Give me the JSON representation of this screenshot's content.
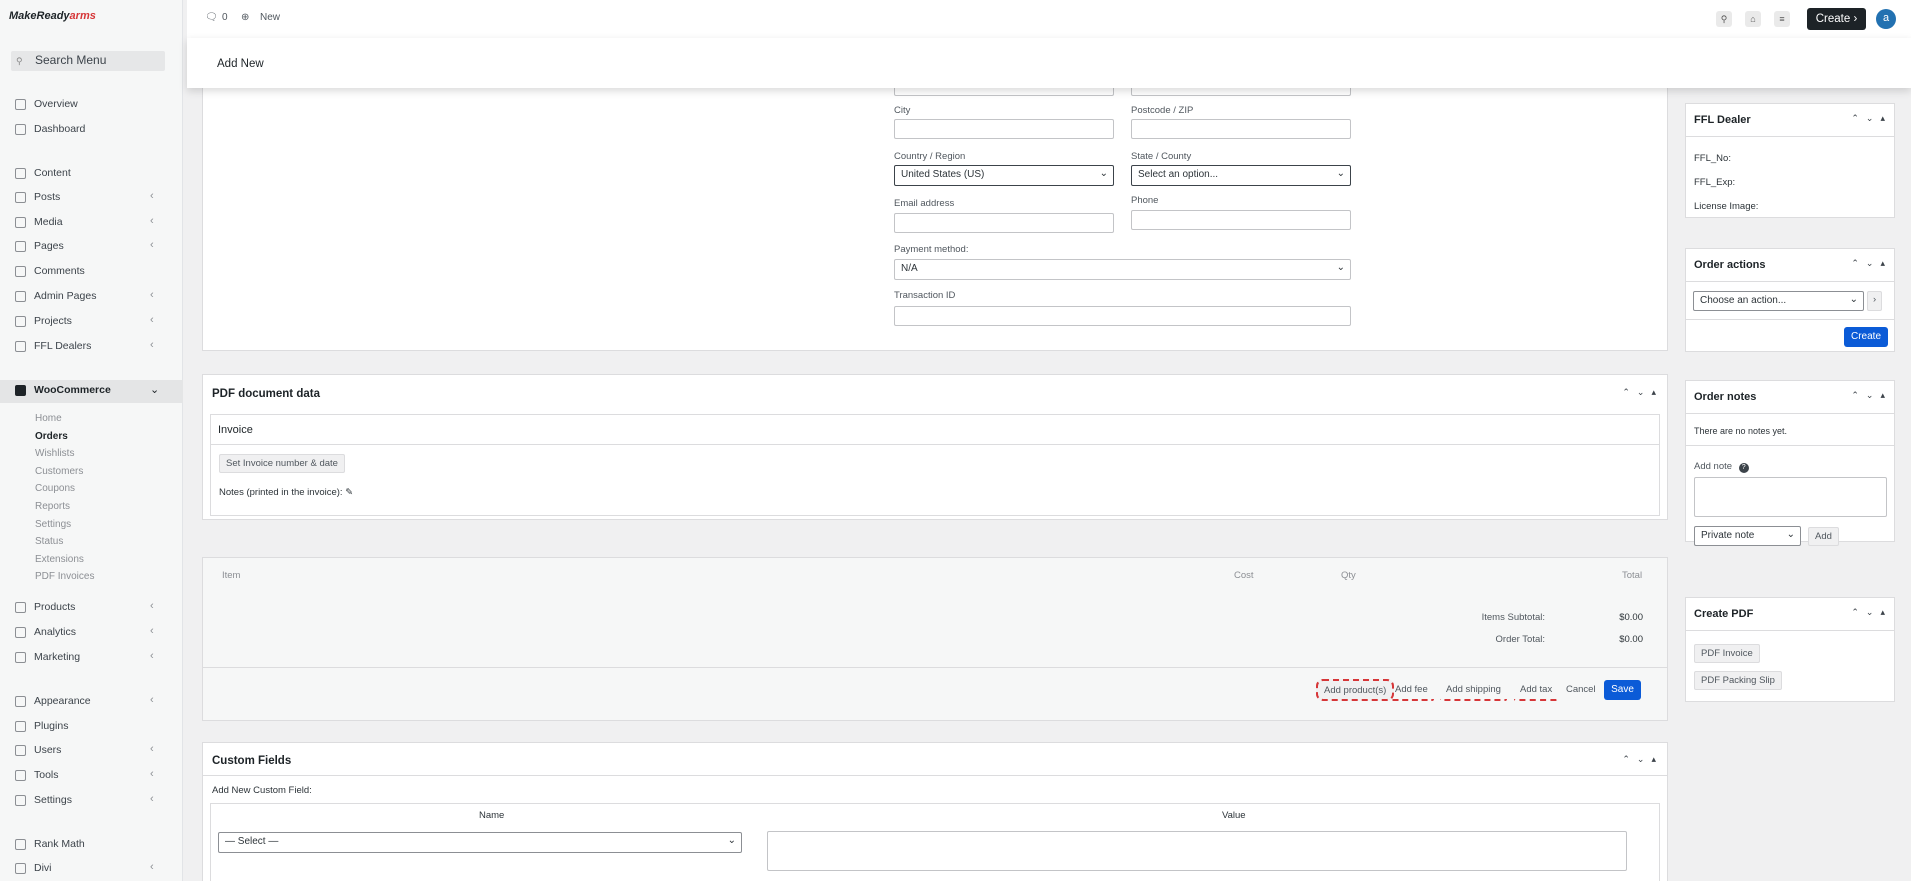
{
  "logo": {
    "make": "MakeReady",
    "arms": "arms"
  },
  "search_menu": {
    "placeholder": "Search Menu"
  },
  "nav": {
    "overview": "Overview",
    "dashboard": "Dashboard",
    "content": "Content",
    "posts": "Posts",
    "media": "Media",
    "pages": "Pages",
    "comments": "Comments",
    "admin_pages": "Admin Pages",
    "projects": "Projects",
    "ffl_dealers": "FFL Dealers",
    "woocommerce": "WooCommerce",
    "woo_sub": [
      "Home",
      "Orders",
      "Wishlists",
      "Customers",
      "Coupons",
      "Reports",
      "Settings",
      "Status",
      "Extensions",
      "PDF Invoices"
    ],
    "products": "Products",
    "analytics": "Analytics",
    "marketing": "Marketing",
    "appearance": "Appearance",
    "plugins": "Plugins",
    "users": "Users",
    "tools": "Tools",
    "settings": "Settings",
    "rank_math": "Rank Math",
    "divi": "Divi"
  },
  "topbar": {
    "comments_count": "0",
    "new_label": "New",
    "create_label": "Create",
    "avatar_letter": "a"
  },
  "subheader": {
    "title": "Add New"
  },
  "address": {
    "city_label": "City",
    "postcode_label": "Postcode / ZIP",
    "country_label": "Country / Region",
    "country_value": "United States (US)",
    "state_label": "State / County",
    "state_value": "Select an option...",
    "email_label": "Email address",
    "phone_label": "Phone",
    "payment_label": "Payment method:",
    "payment_value": "N/A",
    "transaction_label": "Transaction ID"
  },
  "pdf_data": {
    "title": "PDF document data",
    "invoice_label": "Invoice",
    "set_button": "Set Invoice number & date",
    "notes_label": "Notes (printed in the invoice):"
  },
  "items": {
    "col_item": "Item",
    "col_cost": "Cost",
    "col_qty": "Qty",
    "col_total": "Total",
    "subtotal_label": "Items Subtotal:",
    "subtotal_value": "$0.00",
    "order_total_label": "Order Total:",
    "order_total_value": "$0.00",
    "btn_add_products": "Add product(s)",
    "btn_add_fee": "Add fee",
    "btn_add_shipping": "Add shipping",
    "btn_add_tax": "Add tax",
    "btn_cancel": "Cancel",
    "btn_save": "Save"
  },
  "custom_fields": {
    "title": "Custom Fields",
    "add_label": "Add New Custom Field:",
    "col_name": "Name",
    "col_value": "Value",
    "select_value": "— Select —"
  },
  "ffl": {
    "title": "FFL Dealer",
    "no": "FFL_No:",
    "exp": "FFL_Exp:",
    "license": "License Image:"
  },
  "order_actions": {
    "title": "Order actions",
    "select_value": "Choose an action...",
    "create_button": "Create"
  },
  "order_notes": {
    "title": "Order notes",
    "empty": "There are no notes yet.",
    "add_note_label": "Add note",
    "note_type": "Private note",
    "add_button": "Add"
  },
  "create_pdf": {
    "title": "Create PDF",
    "invoice_button": "PDF Invoice",
    "packing_button": "PDF Packing Slip"
  }
}
